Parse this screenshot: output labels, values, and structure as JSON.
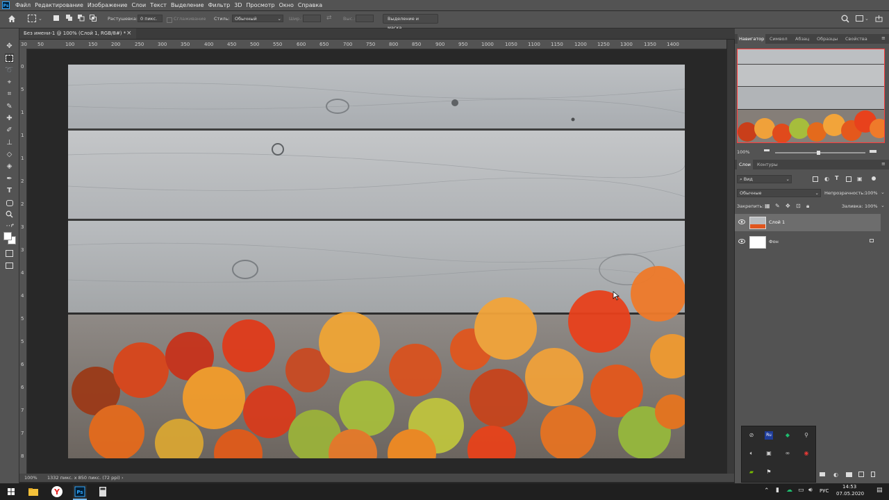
{
  "app": {
    "logo": "Ps"
  },
  "menu": [
    "Файл",
    "Редактирование",
    "Изображение",
    "Слои",
    "Текст",
    "Выделение",
    "Фильтр",
    "3D",
    "Просмотр",
    "Окно",
    "Справка"
  ],
  "options": {
    "feather_label": "Растушевка:",
    "feather_value": "0 пикс.",
    "antialias_label": "Сглаживание",
    "style_label": "Стиль:",
    "style_value": "Обычный",
    "width_label": "Шир.:",
    "height_label": "Выс.:",
    "select_mask_button": "Выделение и маска..."
  },
  "document": {
    "tab_title": "Без имени-1 @ 100% (Слой 1, RGB/8#) *",
    "tab_close": "×"
  },
  "ruler_h": [
    "30",
    "50",
    "100",
    "150",
    "200",
    "250",
    "300",
    "350",
    "400",
    "450",
    "500",
    "550",
    "600",
    "650",
    "700",
    "750",
    "800",
    "850",
    "900",
    "950",
    "1000",
    "1050",
    "1100",
    "1150",
    "1200",
    "1250",
    "1300",
    "1350",
    "1400"
  ],
  "ruler_v": [
    "0",
    "5",
    "1",
    "1",
    "1",
    "2",
    "2",
    "3",
    "3",
    "4",
    "4",
    "5",
    "5",
    "6",
    "6",
    "7",
    "7",
    "8"
  ],
  "status": {
    "zoom": "100%",
    "info": "1332 пикс. x 850 пикс. (72 ppi)",
    "arrow": "›"
  },
  "panels": {
    "top_tabs": [
      "Навигатор",
      "Символ",
      "Абзац",
      "Образцы",
      "Свойства"
    ],
    "navigator_zoom": "100%",
    "layers_tabs": [
      "Слои",
      "Контуры"
    ],
    "filter_label": "Вид",
    "blend_mode": "Обычные",
    "opacity_label": "Непрозрачность:",
    "opacity_value": "100%",
    "lock_label": "Закрепить:",
    "fill_label": "Заливка:",
    "fill_value": "100%",
    "layers": [
      {
        "name": "Слой 1",
        "selected": true
      },
      {
        "name": "Фон",
        "locked": true
      }
    ]
  },
  "taskbar": {
    "lang": "РУС",
    "time": "14:53",
    "date": "07.05.2020"
  },
  "colors": {
    "accent": "#31a8ff",
    "panel_bg": "#535353",
    "selected_layer": "#6d6d6d"
  }
}
